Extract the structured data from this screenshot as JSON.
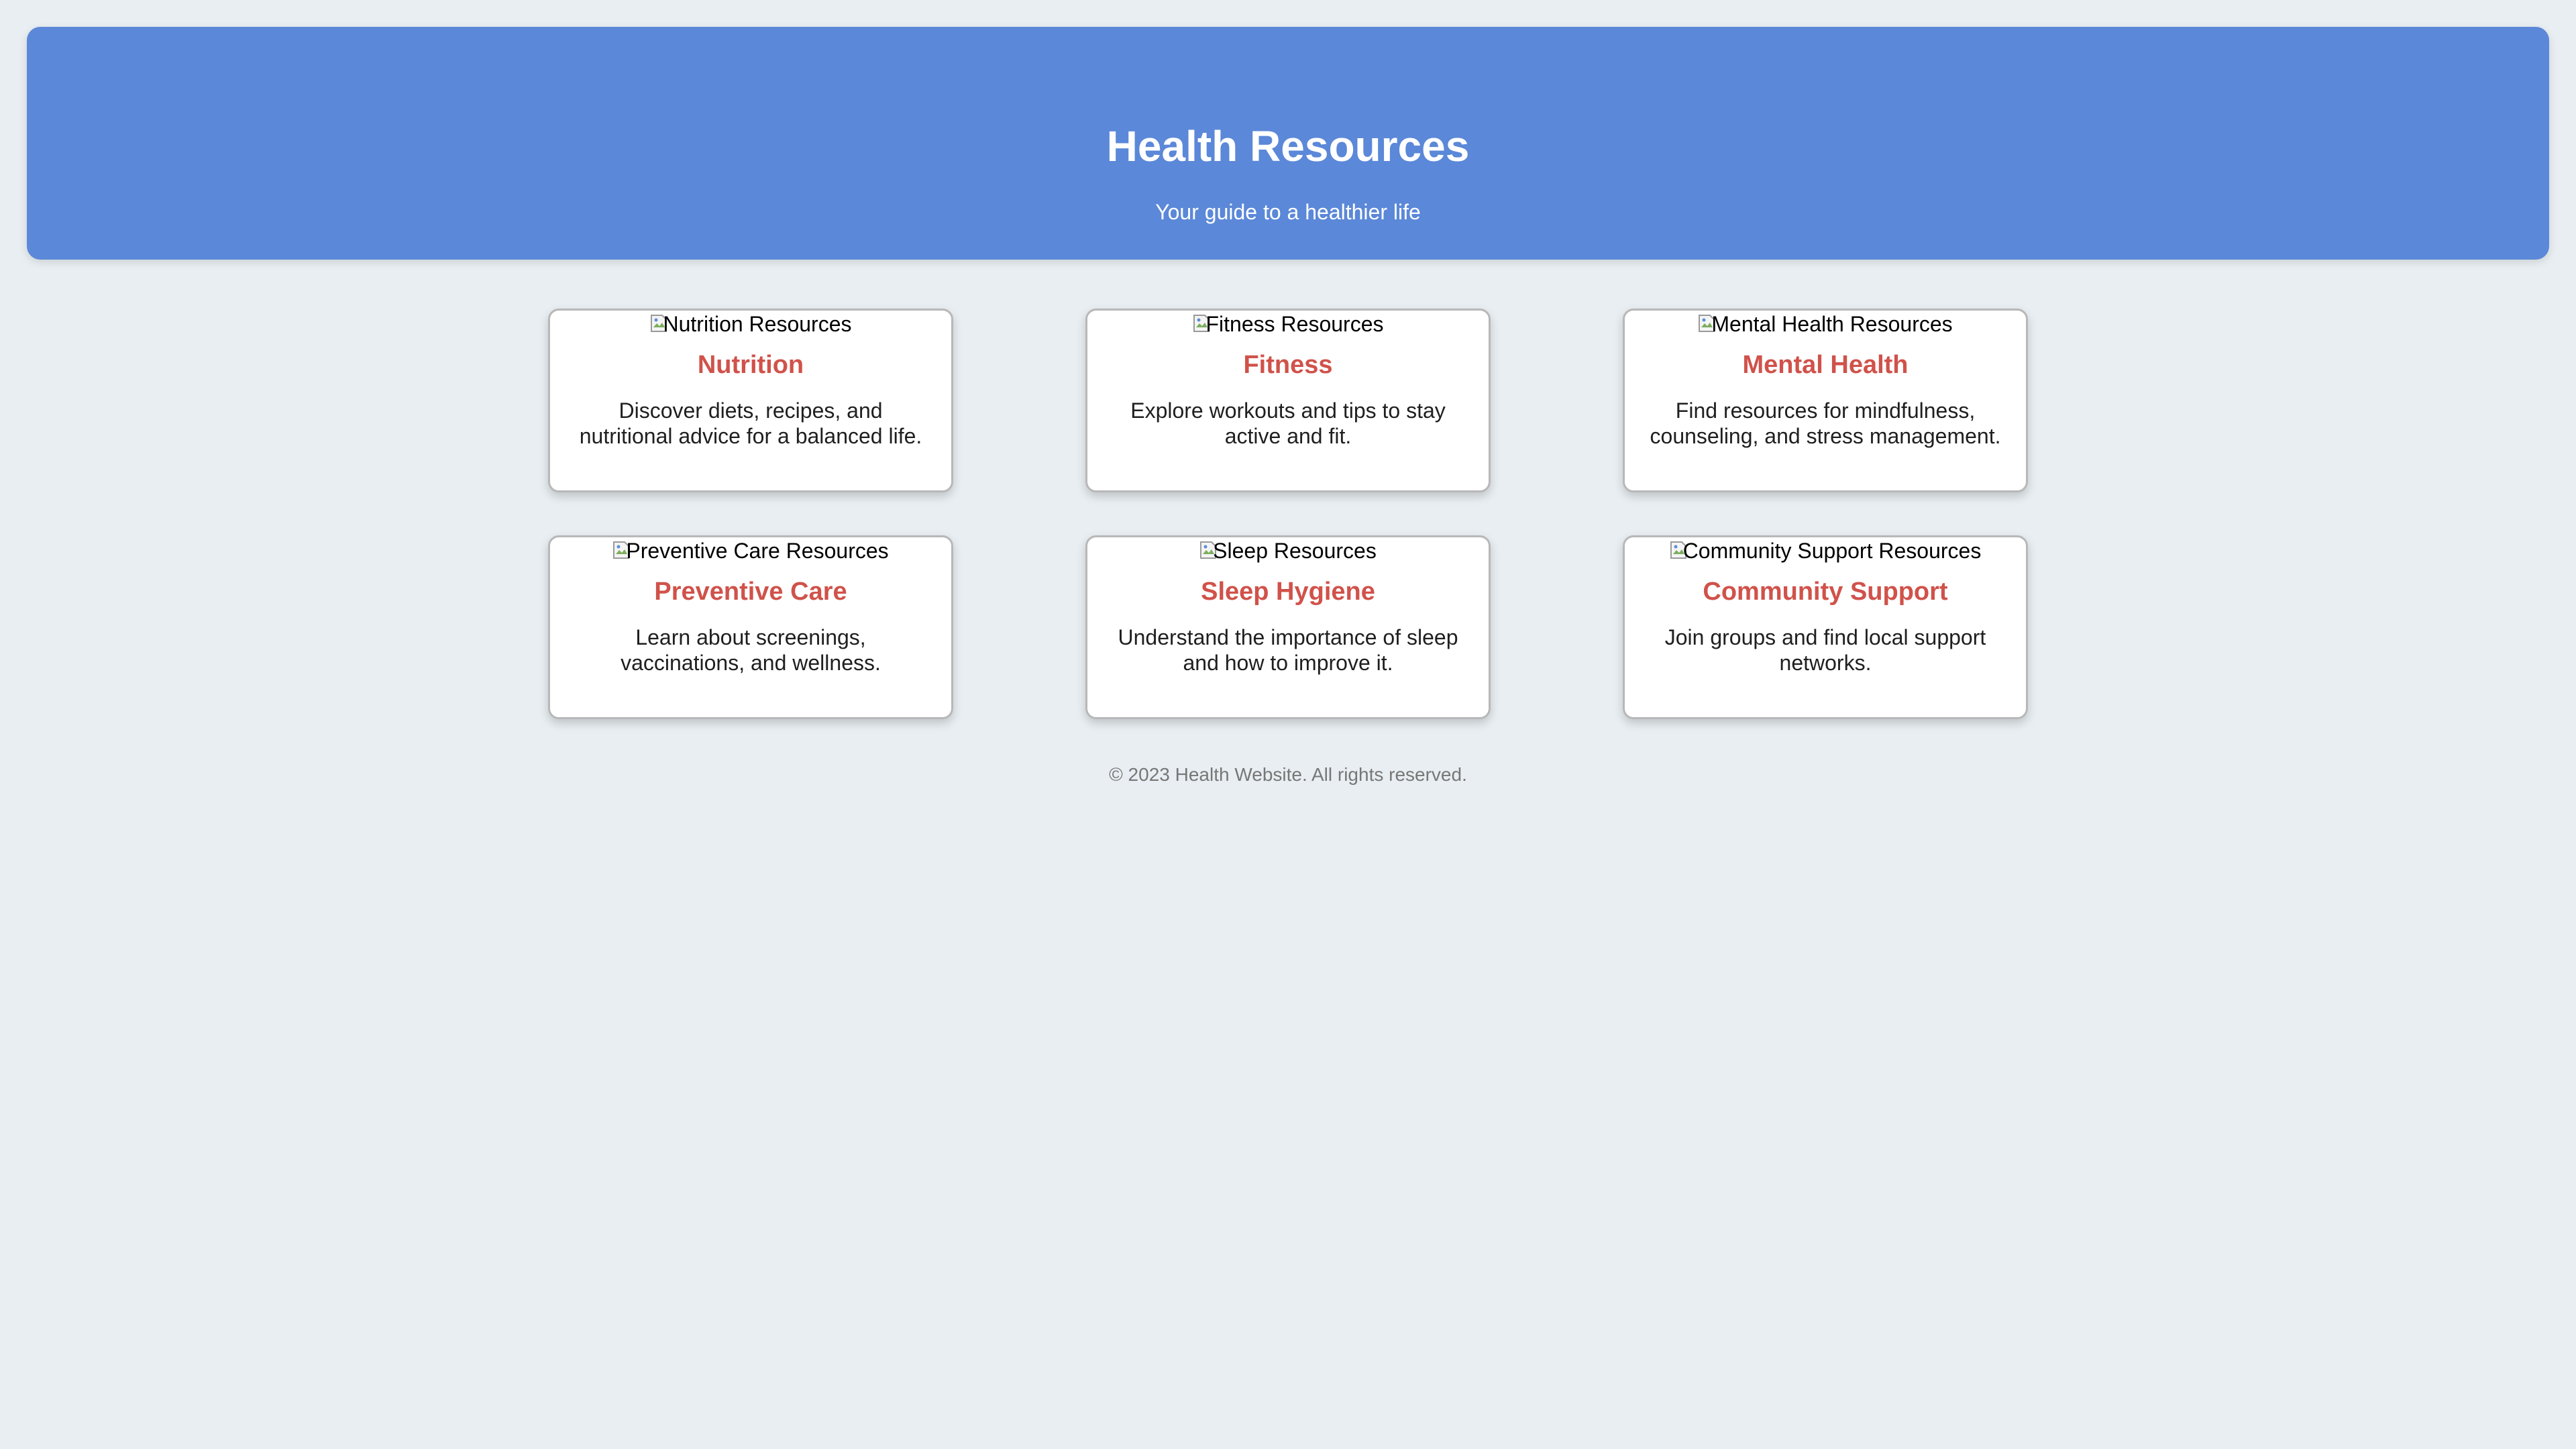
{
  "header": {
    "title": "Health Resources",
    "subtitle": "Your guide to a healthier life"
  },
  "cards": [
    {
      "image_alt": "Nutrition Resources",
      "title": "Nutrition",
      "description": "Discover diets, recipes, and nutritional advice for a balanced life."
    },
    {
      "image_alt": "Fitness Resources",
      "title": "Fitness",
      "description": "Explore workouts and tips to stay active and fit."
    },
    {
      "image_alt": "Mental Health Resources",
      "title": "Mental Health",
      "description": "Find resources for mindfulness, counseling, and stress management."
    },
    {
      "image_alt": "Preventive Care Resources",
      "title": "Preventive Care",
      "description": "Learn about screenings, vaccinations, and wellness."
    },
    {
      "image_alt": "Sleep Resources",
      "title": "Sleep Hygiene",
      "description": "Understand the importance of sleep and how to improve it."
    },
    {
      "image_alt": "Community Support Resources",
      "title": "Community Support",
      "description": "Join groups and find local support networks."
    }
  ],
  "footer": {
    "copyright": "© 2023 Health Website. All rights reserved."
  },
  "icons": {
    "broken_image": "broken-image-icon"
  },
  "colors": {
    "header_bg": "#5b88d8",
    "card_title": "#d0524a",
    "page_bg": "#e8eef1"
  }
}
